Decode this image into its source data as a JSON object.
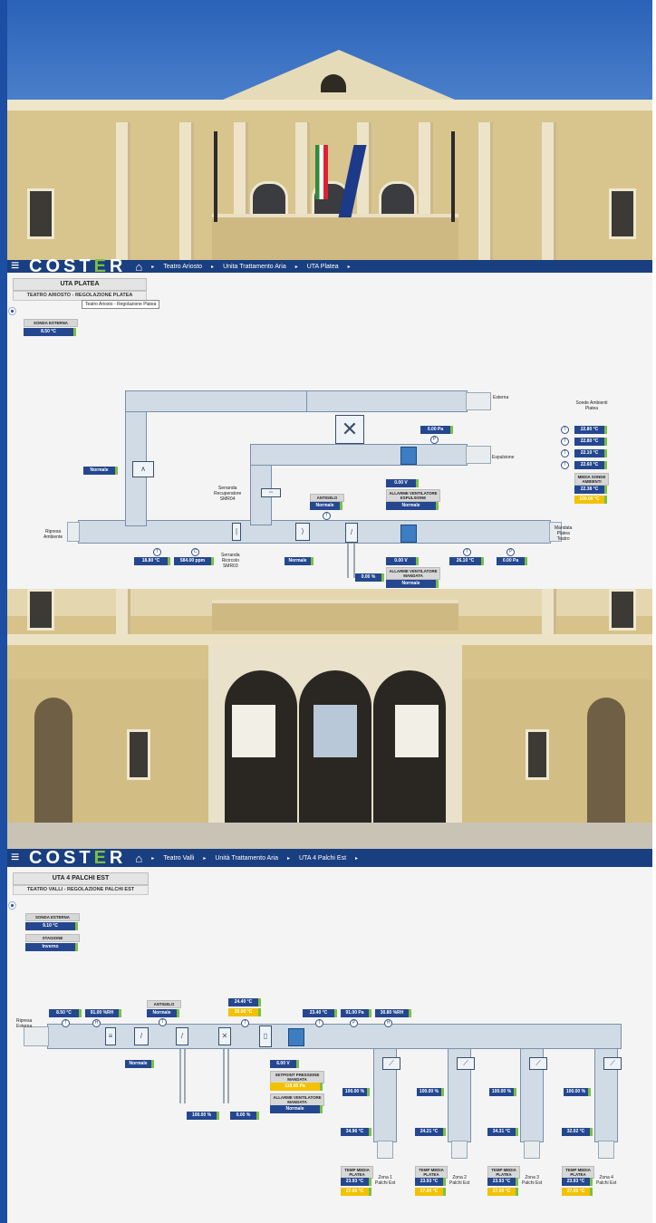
{
  "colors": {
    "nav": "#1a3f80",
    "value_bg": "#24478f",
    "accent_green": "#7ac143",
    "setpoint_yellow": "#f2c200"
  },
  "nav1": {
    "menu_icon": "≡",
    "brand_prefix": "COST",
    "brand_e": "E",
    "brand_suffix": "R",
    "home_icon": "⌂",
    "crumbs": [
      "Teatro Ariosto",
      "Unita Trattamento Aria",
      "UTA Platea"
    ],
    "sep": "▸"
  },
  "panel1": {
    "title": "UTA PLATEA",
    "subtitle": "TEATRO ARIOSTO - REGOLAZIONE PLATEA",
    "tooltip": "Teatro Ariosto - Regolazione Platea",
    "sonda_esterna_label": "SONDA ESTERNA",
    "sonda_esterna_value": "8.50 °C",
    "labels": {
      "esterna": "Esterna",
      "espulsione": "Espulsione",
      "ripresa": "Ripresa\nAmbiente",
      "mandata": "Mandata\nPlatea\nTeatro",
      "serranda_rec": "Serranda\nRecuperatore\nSMR04",
      "serranda_ric": "Serranda\nRicircolo\nSMR03",
      "antigelo": "ANTIGELO",
      "allarme_esp": "ALLARME VENTILATORE\nESPULSIONE",
      "allarme_man": "ALLARME VENTILATORE\nMANDATA",
      "sonde_title": "Sonde Ambienti\nPlatea",
      "media_label": "MEDIA SONDE\nAMBIENTI"
    },
    "values": {
      "serranda_bypass": "Normale",
      "esp_pressure": "0.00 Pa",
      "esp_voltage": "0.00 V",
      "esp_alarm": "Normale",
      "antigelo": "Normale",
      "ripresa_temp": "18.80 °C",
      "ripresa_co2": "584.00 ppm",
      "serranda_status": "Normale",
      "valve": "0.00 %",
      "man_voltage": "0.00 V",
      "man_alarm": "Normale",
      "man_temp": "26.10 °C",
      "man_pressure": "0.00 Pa",
      "sonde": [
        "22.80 °C",
        "22.80 °C",
        "22.10 °C",
        "22.60 °C"
      ],
      "media": "22.38 °C",
      "media_setpoint": "100.00 °C"
    }
  },
  "nav2": {
    "menu_icon": "≡",
    "brand_prefix": "COST",
    "brand_e": "E",
    "brand_suffix": "R",
    "home_icon": "⌂",
    "crumbs": [
      "Teatro Valli",
      "Unità Trattamento Aria",
      "UTA 4 Palchi Est"
    ],
    "sep": "▸"
  },
  "panel2": {
    "title": "UTA 4 PALCHI EST",
    "subtitle": "TEATRO VALLI - REGOLAZIONE PALCHI EST",
    "sonda_esterna_label": "SONDA ESTERNA",
    "sonda_esterna_value": "9.10 °C",
    "stagione_label": "STAGIONE",
    "stagione_value": "Inverno",
    "labels": {
      "ripresa": "Ripresa\nEsterna",
      "antigelo": "ANTIGELO",
      "setpoint_label": "SETPOINT PRESSIONE\nMANDATA",
      "allarme_label": "ALLARME VENTILATORE\nMANDATA",
      "temp_media": "TEMP MEDIA\nPLATEA",
      "zones": [
        "Zona 1\nPalchi Est",
        "Zona 2\nPalchi Est",
        "Zona 3\nPalchi Est",
        "Zona 4\nPalchi Est"
      ]
    },
    "values": {
      "ext_temp": "8.50 °C",
      "ext_rh": "91.00 %RH",
      "antigelo": "Normale",
      "coil_temp": "24.40 °C",
      "coil_setpoint": "30.00 °C",
      "man_temp": "23.40 °C",
      "man_pressure": "91.00 Pa",
      "man_rh": "30.80 %RH",
      "serranda_status": "Normale",
      "valve1": "100.00 %",
      "valve2": "0.00 %",
      "fan_voltage": "6.00 V",
      "setpoint": "110.00 Pa",
      "alarm": "Normale",
      "zone_dampers": [
        "100.00 %",
        "100.00 %",
        "100.00 %",
        "100.00 %"
      ],
      "zone_temps": [
        "34.96 °C",
        "24.21 °C",
        "34.31 °C",
        "32.02 °C"
      ],
      "zone_media": [
        "23.93 °C",
        "23.93 °C",
        "23.93 °C",
        "23.93 °C"
      ],
      "zone_setpoints": [
        "27.00 °C",
        "27.00 °C",
        "27.00 °C",
        "27.00 °C"
      ]
    }
  }
}
